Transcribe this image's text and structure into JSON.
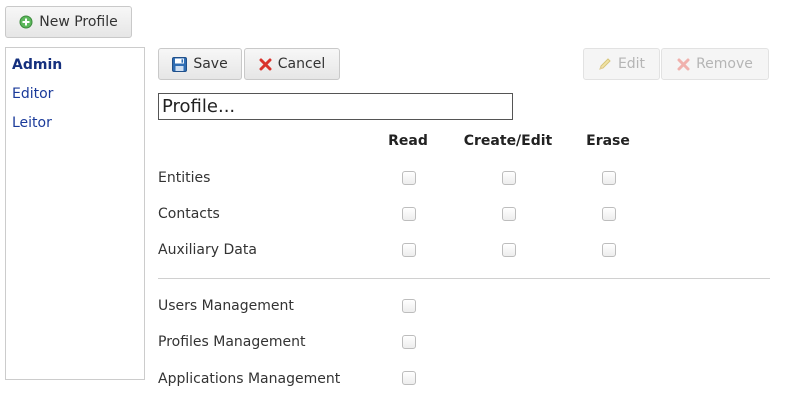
{
  "toolbar": {
    "new_profile_label": "New Profile",
    "save_label": "Save",
    "cancel_label": "Cancel",
    "edit_label": "Edit",
    "remove_label": "Remove"
  },
  "profiles": [
    {
      "label": "Admin",
      "selected": true
    },
    {
      "label": "Editor",
      "selected": false
    },
    {
      "label": "Leitor",
      "selected": false
    }
  ],
  "form": {
    "profile_name_value": "Profile...",
    "columns": [
      "Read",
      "Create/Edit",
      "Erase"
    ],
    "rows": [
      {
        "label": "Entities",
        "checks": [
          false,
          false,
          false
        ]
      },
      {
        "label": "Contacts",
        "checks": [
          false,
          false,
          false
        ]
      },
      {
        "label": "Auxiliary Data",
        "checks": [
          false,
          false,
          false
        ]
      }
    ],
    "management_rows": [
      {
        "label": "Users Management",
        "checked": false
      },
      {
        "label": "Profiles Management",
        "checked": false
      },
      {
        "label": "Applications Management",
        "checked": false
      }
    ]
  },
  "icons": {
    "new_profile": "plus-circle-icon",
    "save": "floppy-disk-icon",
    "cancel": "x-mark-icon",
    "edit": "pencil-icon",
    "remove": "x-mark-icon"
  },
  "colors": {
    "link": "#1a3a9a",
    "cancel_red": "#d9322b",
    "plus_green": "#4caf50",
    "save_blue": "#2f6db3"
  }
}
